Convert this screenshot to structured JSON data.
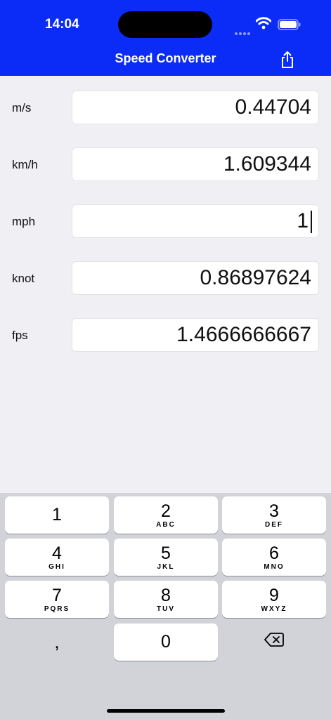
{
  "status": {
    "time": "14:04"
  },
  "nav": {
    "title": "Speed Converter"
  },
  "rows": [
    {
      "label": "m/s",
      "value": "0.44704"
    },
    {
      "label": "km/h",
      "value": "1.609344"
    },
    {
      "label": "mph",
      "value": "1"
    },
    {
      "label": "knot",
      "value": "0.86897624"
    },
    {
      "label": "fps",
      "value": "1.4666666667"
    }
  ],
  "keyboard": {
    "keys": [
      {
        "digit": "1",
        "letters": ""
      },
      {
        "digit": "2",
        "letters": "ABC"
      },
      {
        "digit": "3",
        "letters": "DEF"
      },
      {
        "digit": "4",
        "letters": "GHI"
      },
      {
        "digit": "5",
        "letters": "JKL"
      },
      {
        "digit": "6",
        "letters": "MNO"
      },
      {
        "digit": "7",
        "letters": "PQRS"
      },
      {
        "digit": "8",
        "letters": "TUV"
      },
      {
        "digit": "9",
        "letters": "WXYZ"
      },
      {
        "digit": "0",
        "letters": ""
      }
    ],
    "comma": ",",
    "delete_icon": "delete-backward-icon"
  },
  "colors": {
    "nav_background": "#0a2cf6",
    "page_background": "#efeff4",
    "keyboard_background": "#d1d3d9"
  }
}
